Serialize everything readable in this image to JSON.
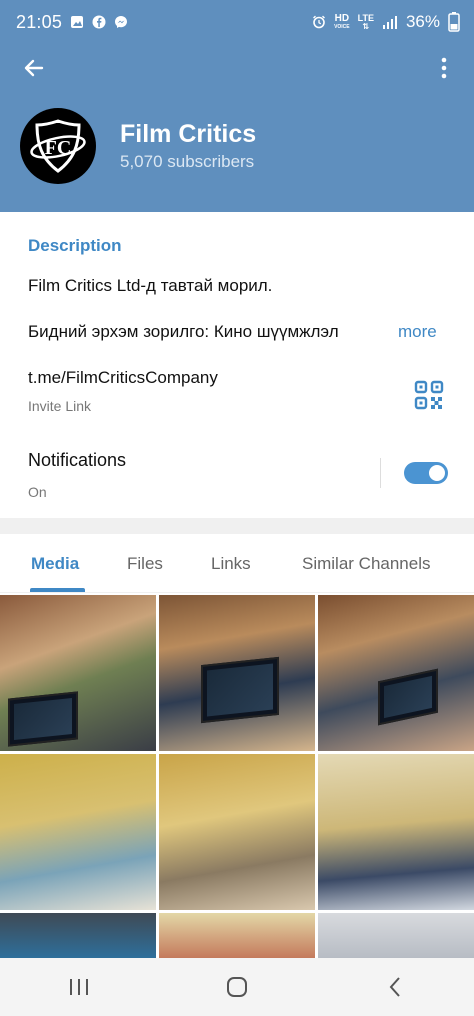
{
  "status_bar": {
    "time": "21:05",
    "left_icons": [
      "gallery-icon",
      "facebook-icon",
      "messenger-icon"
    ],
    "right_icons": [
      "alarm-icon",
      "hd-voice-icon",
      "lte-icon",
      "signal-icon"
    ],
    "hd_label": "HD",
    "voice_label": "VOICE",
    "lte_label": "LTE",
    "battery": "36%"
  },
  "appbar": {
    "back_icon": "arrow-left-icon",
    "menu_icon": "more-vertical-icon"
  },
  "channel": {
    "avatar_text": "FC",
    "title": "Film Critics",
    "subscribers": "5,070 subscribers"
  },
  "info": {
    "description_title": "Description",
    "description_line1": "Film Critics Ltd-д тавтай морил.",
    "description_line2": "Бидний эрхэм зорилго: Кино шүүмжлэл",
    "more_label": "more",
    "link": "t.me/FilmCriticsCompany",
    "link_caption": "Invite Link",
    "qr_icon": "qr-code-icon",
    "notifications_label": "Notifications",
    "notifications_state": "On",
    "notifications_enabled": true
  },
  "tabs": [
    {
      "label": "Media",
      "active": true
    },
    {
      "label": "Files",
      "active": false
    },
    {
      "label": "Links",
      "active": false
    },
    {
      "label": "Similar Channels",
      "active": false
    }
  ],
  "media_count_visible": 9,
  "navbar": {
    "icons": [
      "recent-apps-icon",
      "home-icon",
      "back-nav-icon"
    ]
  },
  "colors": {
    "header": "#5f8fbe",
    "accent": "#3f88c5"
  }
}
